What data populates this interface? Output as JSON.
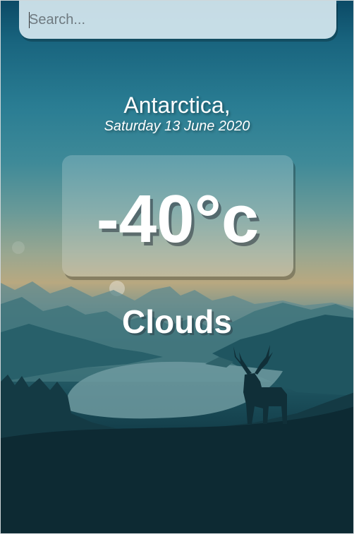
{
  "search": {
    "placeholder": "Search..."
  },
  "weather": {
    "location": "Antarctica,",
    "date": "Saturday 13 June 2020",
    "temperature": "-40°c",
    "condition": "Clouds"
  },
  "colors": {
    "sky_top": "#0b4a66",
    "horizon_glow": "#b8a880",
    "ground_dark": "#0a2029",
    "text": "#ffffff"
  }
}
